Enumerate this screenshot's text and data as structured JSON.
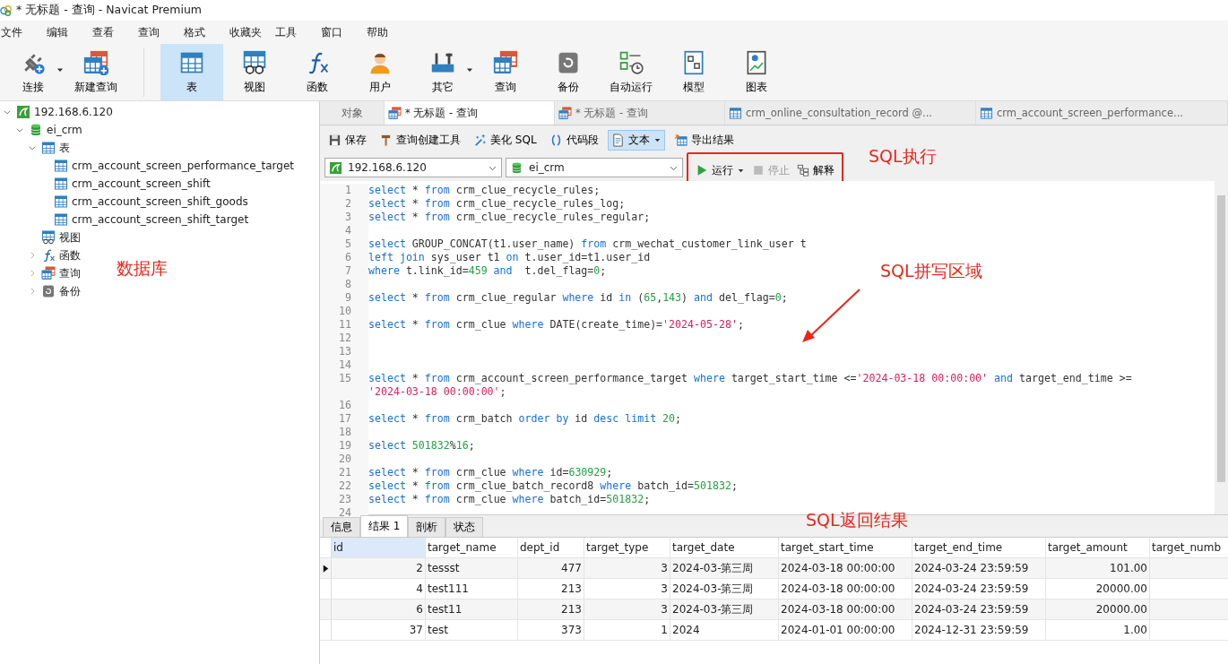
{
  "window": {
    "title": "* 无标题 - 查询 - Navicat Premium"
  },
  "menu": [
    "文件",
    "编辑",
    "查看",
    "查询",
    "格式",
    "收藏夹",
    "工具",
    "窗口",
    "帮助"
  ],
  "toolbar": [
    {
      "label": "连接",
      "kind": "plug",
      "selected": false,
      "dropdown": true
    },
    {
      "label": "新建查询",
      "kind": "newquery",
      "selected": false,
      "dropdown": false
    },
    {
      "label": "表",
      "kind": "table",
      "selected": true,
      "dropdown": false
    },
    {
      "label": "视图",
      "kind": "view",
      "selected": false,
      "dropdown": false
    },
    {
      "label": "函数",
      "kind": "function",
      "selected": false,
      "dropdown": false
    },
    {
      "label": "用户",
      "kind": "user",
      "selected": false,
      "dropdown": false
    },
    {
      "label": "其它",
      "kind": "tools",
      "selected": false,
      "dropdown": true
    },
    {
      "label": "查询",
      "kind": "query",
      "selected": false,
      "dropdown": false
    },
    {
      "label": "备份",
      "kind": "backup",
      "selected": false,
      "dropdown": false
    },
    {
      "label": "自动运行",
      "kind": "autorun",
      "selected": false,
      "dropdown": false
    },
    {
      "label": "模型",
      "kind": "model",
      "selected": false,
      "dropdown": false
    },
    {
      "label": "图表",
      "kind": "chart",
      "selected": false,
      "dropdown": false
    }
  ],
  "tree": [
    {
      "label": "192.168.6.120",
      "kind": "server",
      "expanded": true,
      "children": [
        {
          "label": "ei_crm",
          "kind": "database",
          "expanded": true,
          "children": [
            {
              "label": "表",
              "kind": "table",
              "expanded": true,
              "children": [
                {
                  "label": "crm_account_screen_performance_target",
                  "kind": "table"
                },
                {
                  "label": "crm_account_screen_shift",
                  "kind": "table"
                },
                {
                  "label": "crm_account_screen_shift_goods",
                  "kind": "table"
                },
                {
                  "label": "crm_account_screen_shift_target",
                  "kind": "table"
                }
              ]
            },
            {
              "label": "视图",
              "kind": "view"
            },
            {
              "label": "函数",
              "kind": "function",
              "expanded": false
            },
            {
              "label": "查询",
              "kind": "query",
              "expanded": false
            },
            {
              "label": "备份",
              "kind": "backup",
              "expanded": false
            }
          ]
        }
      ]
    }
  ],
  "doc_tabs": [
    {
      "label": "对象",
      "kind": "plain",
      "selected": false
    },
    {
      "label": "* 无标题 - 查询",
      "kind": "query",
      "selected": true
    },
    {
      "label": "* 无标题 - 查询",
      "kind": "query",
      "selected": false
    },
    {
      "label": "crm_online_consultation_record @...",
      "kind": "table",
      "selected": false
    },
    {
      "label": "crm_account_screen_performance...",
      "kind": "table",
      "selected": false
    }
  ],
  "editor_toolbar": [
    {
      "label": "保存",
      "kind": "save",
      "selected": false,
      "dropdown": false
    },
    {
      "label": "查询创建工具",
      "kind": "hammer",
      "selected": false,
      "dropdown": false
    },
    {
      "label": "美化 SQL",
      "kind": "wand",
      "selected": false,
      "dropdown": false
    },
    {
      "label": "代码段",
      "kind": "braces",
      "selected": false,
      "dropdown": false
    },
    {
      "label": "文本",
      "kind": "doc",
      "selected": true,
      "dropdown": true
    },
    {
      "label": "导出结果",
      "kind": "export",
      "selected": false,
      "dropdown": false
    }
  ],
  "connection": {
    "value": "192.168.6.120"
  },
  "database": {
    "value": "ei_crm"
  },
  "run_group": {
    "highlighted": true,
    "buttons": [
      {
        "label": "运行",
        "kind": "play",
        "disabled": false,
        "dropdown": true
      },
      {
        "label": "停止",
        "kind": "stop",
        "disabled": true,
        "dropdown": false
      },
      {
        "label": "解释",
        "kind": "explain",
        "disabled": false,
        "dropdown": false
      }
    ]
  },
  "code": [
    {
      "no": "1",
      "tokens": [
        {
          "kind": "kw",
          "text": "select"
        },
        {
          "kind": "plain",
          "text": " * "
        },
        {
          "kind": "kw",
          "text": "from"
        },
        {
          "kind": "plain",
          "text": " crm_clue_recycle_rules;"
        }
      ]
    },
    {
      "no": "2",
      "tokens": [
        {
          "kind": "kw",
          "text": "select"
        },
        {
          "kind": "plain",
          "text": " * "
        },
        {
          "kind": "kw",
          "text": "from"
        },
        {
          "kind": "plain",
          "text": " crm_clue_recycle_rules_log;"
        }
      ]
    },
    {
      "no": "3",
      "tokens": [
        {
          "kind": "kw",
          "text": "select"
        },
        {
          "kind": "plain",
          "text": " * "
        },
        {
          "kind": "kw",
          "text": "from"
        },
        {
          "kind": "plain",
          "text": " crm_clue_recycle_rules_regular;"
        }
      ]
    },
    {
      "no": "4"
    },
    {
      "no": "5",
      "tokens": [
        {
          "kind": "kw",
          "text": "select"
        },
        {
          "kind": "plain",
          "text": " GROUP_CONCAT(t1.user_name) "
        },
        {
          "kind": "kw",
          "text": "from"
        },
        {
          "kind": "plain",
          "text": " crm_wechat_customer_link_user t"
        }
      ]
    },
    {
      "no": "6",
      "tokens": [
        {
          "kind": "kw",
          "text": "left join"
        },
        {
          "kind": "plain",
          "text": " sys_user t1 "
        },
        {
          "kind": "kw",
          "text": "on"
        },
        {
          "kind": "plain",
          "text": " t.user_id=t1.user_id"
        }
      ]
    },
    {
      "no": "7",
      "tokens": [
        {
          "kind": "kw",
          "text": "where"
        },
        {
          "kind": "plain",
          "text": " t.link_id="
        },
        {
          "kind": "num",
          "text": "459"
        },
        {
          "kind": "kw",
          "text": " and"
        },
        {
          "kind": "plain",
          "text": "  t.del_flag="
        },
        {
          "kind": "num",
          "text": "0"
        },
        {
          "kind": "plain",
          "text": ";"
        }
      ]
    },
    {
      "no": "8"
    },
    {
      "no": "9",
      "tokens": [
        {
          "kind": "kw",
          "text": "select"
        },
        {
          "kind": "plain",
          "text": " * "
        },
        {
          "kind": "kw",
          "text": "from"
        },
        {
          "kind": "plain",
          "text": " crm_clue_regular "
        },
        {
          "kind": "kw",
          "text": "where"
        },
        {
          "kind": "plain",
          "text": " id "
        },
        {
          "kind": "kw",
          "text": "in"
        },
        {
          "kind": "plain",
          "text": " ("
        },
        {
          "kind": "num",
          "text": "65"
        },
        {
          "kind": "plain",
          "text": ","
        },
        {
          "kind": "num",
          "text": "143"
        },
        {
          "kind": "plain",
          "text": ") "
        },
        {
          "kind": "kw",
          "text": "and"
        },
        {
          "kind": "plain",
          "text": " del_flag="
        },
        {
          "kind": "num",
          "text": "0"
        },
        {
          "kind": "plain",
          "text": ";"
        }
      ]
    },
    {
      "no": "10"
    },
    {
      "no": "11",
      "tokens": [
        {
          "kind": "kw",
          "text": "select"
        },
        {
          "kind": "plain",
          "text": " * "
        },
        {
          "kind": "kw",
          "text": "from"
        },
        {
          "kind": "plain",
          "text": " crm_clue "
        },
        {
          "kind": "kw",
          "text": "where"
        },
        {
          "kind": "plain",
          "text": " DATE(create_time)="
        },
        {
          "kind": "str",
          "text": "'2024-05-28'"
        },
        {
          "kind": "plain",
          "text": ";"
        }
      ]
    },
    {
      "no": "12"
    },
    {
      "no": "13"
    },
    {
      "no": "14"
    },
    {
      "no": "15",
      "tokens": [
        {
          "kind": "kw",
          "text": "select"
        },
        {
          "kind": "plain",
          "text": " * "
        },
        {
          "kind": "kw",
          "text": "from"
        },
        {
          "kind": "plain",
          "text": " crm_account_screen_performance_target "
        },
        {
          "kind": "kw",
          "text": "where"
        },
        {
          "kind": "plain",
          "text": " target_start_time <="
        },
        {
          "kind": "str",
          "text": "'2024-03-18 00:00:00'"
        },
        {
          "kind": "kw",
          "text": " and"
        },
        {
          "kind": "plain",
          "text": " target_end_time >="
        },
        {
          "kind": "wrap"
        },
        {
          "kind": "str",
          "text": "'2024-03-18 00:00:00'"
        },
        {
          "kind": "plain",
          "text": ";"
        }
      ]
    },
    {
      "no": "16"
    },
    {
      "no": "17",
      "tokens": [
        {
          "kind": "kw",
          "text": "select"
        },
        {
          "kind": "plain",
          "text": " * "
        },
        {
          "kind": "kw",
          "text": "from"
        },
        {
          "kind": "plain",
          "text": " crm_batch "
        },
        {
          "kind": "kw",
          "text": "order by"
        },
        {
          "kind": "plain",
          "text": " id "
        },
        {
          "kind": "kw",
          "text": "desc"
        },
        {
          "kind": "kw",
          "text": " limit"
        },
        {
          "kind": "num",
          "text": " 20"
        },
        {
          "kind": "plain",
          "text": ";"
        }
      ]
    },
    {
      "no": "18"
    },
    {
      "no": "19",
      "tokens": [
        {
          "kind": "kw",
          "text": "select"
        },
        {
          "kind": "num",
          "text": " 501832"
        },
        {
          "kind": "plain",
          "text": "%"
        },
        {
          "kind": "num",
          "text": "16"
        },
        {
          "kind": "plain",
          "text": ";"
        }
      ]
    },
    {
      "no": "20"
    },
    {
      "no": "21",
      "tokens": [
        {
          "kind": "kw",
          "text": "select"
        },
        {
          "kind": "plain",
          "text": " * "
        },
        {
          "kind": "kw",
          "text": "from"
        },
        {
          "kind": "plain",
          "text": " crm_clue "
        },
        {
          "kind": "kw",
          "text": "where"
        },
        {
          "kind": "plain",
          "text": " id="
        },
        {
          "kind": "num",
          "text": "630929"
        },
        {
          "kind": "plain",
          "text": ";"
        }
      ]
    },
    {
      "no": "22",
      "tokens": [
        {
          "kind": "kw",
          "text": "select"
        },
        {
          "kind": "plain",
          "text": " * "
        },
        {
          "kind": "kw",
          "text": "from"
        },
        {
          "kind": "plain",
          "text": " crm_clue_batch_record8 "
        },
        {
          "kind": "kw",
          "text": "where"
        },
        {
          "kind": "plain",
          "text": " batch_id="
        },
        {
          "kind": "num",
          "text": "501832"
        },
        {
          "kind": "plain",
          "text": ";"
        }
      ]
    },
    {
      "no": "23",
      "tokens": [
        {
          "kind": "kw",
          "text": "select"
        },
        {
          "kind": "plain",
          "text": " * "
        },
        {
          "kind": "kw",
          "text": "from"
        },
        {
          "kind": "plain",
          "text": " crm_clue "
        },
        {
          "kind": "kw",
          "text": "where"
        },
        {
          "kind": "plain",
          "text": " batch_id="
        },
        {
          "kind": "num",
          "text": "501832"
        },
        {
          "kind": "plain",
          "text": ";"
        }
      ]
    },
    {
      "no": "24"
    }
  ],
  "result_tabs": [
    {
      "label": "信息",
      "selected": false
    },
    {
      "label": "结果 1",
      "selected": true
    },
    {
      "label": "剖析",
      "selected": false
    },
    {
      "label": "状态",
      "selected": false
    }
  ],
  "result": {
    "columns": [
      {
        "name": "id",
        "numeric": true,
        "selected": true
      },
      {
        "name": "target_name",
        "numeric": false,
        "selected": false
      },
      {
        "name": "dept_id",
        "numeric": true,
        "selected": false
      },
      {
        "name": "target_type",
        "numeric": true,
        "selected": false
      },
      {
        "name": "target_date",
        "numeric": false,
        "selected": false
      },
      {
        "name": "target_start_time",
        "numeric": false,
        "selected": false
      },
      {
        "name": "target_end_time",
        "numeric": false,
        "selected": false
      },
      {
        "name": "target_amount",
        "numeric": true,
        "selected": false
      },
      {
        "name": "target_numb",
        "selected": false
      }
    ],
    "rows": [
      {
        "current": true,
        "cells": [
          "2",
          "tessst",
          "477",
          "3",
          "2024-03-第三周",
          "2024-03-18 00:00:00",
          "2024-03-24 23:59:59",
          "101.00"
        ]
      },
      {
        "current": false,
        "cells": [
          "4",
          "test111",
          "213",
          "3",
          "2024-03-第三周",
          "2024-03-18 00:00:00",
          "2024-03-24 23:59:59",
          "20000.00"
        ]
      },
      {
        "current": false,
        "cells": [
          "6",
          "test11",
          "213",
          "3",
          "2024-03-第三周",
          "2024-03-18 00:00:00",
          "2024-03-24 23:59:59",
          "20000.00"
        ]
      },
      {
        "current": false,
        "cells": [
          "37",
          "test",
          "373",
          "1",
          "2024",
          "2024-01-01 00:00:00",
          "2024-12-31 23:59:59",
          "1.00"
        ]
      }
    ]
  },
  "annotations": [
    {
      "kind": "label",
      "text": "SQL执行"
    },
    {
      "kind": "label",
      "text": "SQL拼写区域"
    },
    {
      "kind": "label",
      "text": "数据库"
    },
    {
      "kind": "label",
      "text": "SQL返回结果"
    },
    {
      "kind": "arrow"
    }
  ]
}
